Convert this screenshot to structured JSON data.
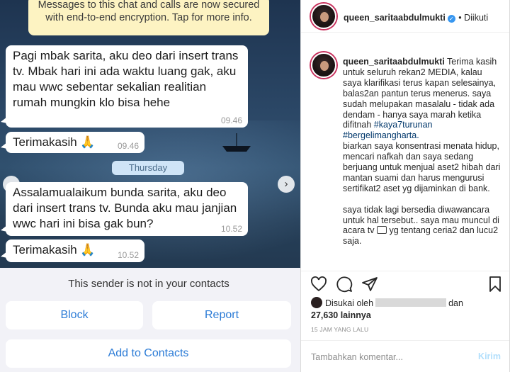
{
  "chat": {
    "system_message": "Messages to this chat and calls are now secured with end-to-end encryption. Tap for more info.",
    "messages": [
      {
        "text": "Pagi mbak sarita, aku deo dari insert trans tv. Mbak hari ini ada waktu luang gak, aku mau wwc sebentar sekalian realitian rumah mungkin klo bisa hehe",
        "time": "09.46"
      },
      {
        "text": "Terimakasih 🙏",
        "time": "09.46"
      },
      {
        "text": "Assalamualaikum bunda sarita, aku deo dari insert trans tv. Bunda aku mau janjian wwc hari ini bisa gak bun?",
        "time": "10.52"
      },
      {
        "text": "Terimakasih 🙏",
        "time": "10.52"
      }
    ],
    "day_separator": "Thursday",
    "nav_prev_icon": "chevron-left-icon",
    "nav_next_icon": "chevron-right-icon",
    "not_in_contacts": "This sender is not in your contacts",
    "block_label": "Block",
    "report_label": "Report",
    "add_contacts_label": "Add to Contacts",
    "accent_color": "#2b7bd6"
  },
  "instagram": {
    "username": "queen_saritaabdulmukti",
    "follow_label": "Diikuti",
    "caption_user": "queen_saritaabdulmukti",
    "caption_lines": [
      "Terima kasih untuk seluruh rekan2 MEDIA, kalau saya klarifikasi terus kapan selesainya, balas2an pantun terus menerus. saya sudah melupakan masalalu - tidak ada dendam - hanya saya marah ketika difitnah",
      "#kaya7turunan #bergelimangharta.",
      "biarkan saya konsentrasi menata hidup, mencari nafkah dan saya sedang berjuang untuk menjual aset2 hibah dari mantan suami dan harus mengurusi sertifikat2 aset yg dijaminkan di bank.",
      "saya tidak lagi bersedia diwawancara untuk hal tersebut.. saya mau muncul di acara tv",
      "yg tentang ceria2 dan lucu2 saja."
    ],
    "liked_by_prefix": "Disukai oleh",
    "liked_by_and": "dan",
    "likes_count": "27,630 lainnya",
    "timestamp": "15 JAM YANG LALU",
    "comment_placeholder": "Tambahkan komentar...",
    "post_label": "Kirim",
    "hashtag_color": "#00376b",
    "icons": [
      "heart-icon",
      "comment-icon",
      "share-icon",
      "bookmark-icon",
      "verified-icon",
      "tv-icon"
    ]
  }
}
